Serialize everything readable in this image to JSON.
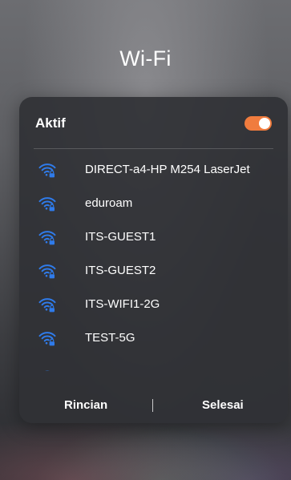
{
  "screen": {
    "title": "Wi-Fi"
  },
  "panel": {
    "active_label": "Aktif",
    "toggle_on": true,
    "accent_color": "#f07c3e",
    "wifi_icon_color": "#2f7bea"
  },
  "networks": [
    {
      "name": "DIRECT-a4-HP M254 LaserJet",
      "icon": "wifi-lock-icon"
    },
    {
      "name": "eduroam",
      "icon": "wifi-lock-icon"
    },
    {
      "name": "ITS-GUEST1",
      "icon": "wifi-lock-icon"
    },
    {
      "name": "ITS-GUEST2",
      "icon": "wifi-lock-icon"
    },
    {
      "name": "ITS-WIFI1-2G",
      "icon": "wifi-lock-icon"
    },
    {
      "name": "TEST-5G",
      "icon": "wifi-lock-icon"
    }
  ],
  "footer": {
    "details_label": "Rincian",
    "done_label": "Selesai"
  }
}
